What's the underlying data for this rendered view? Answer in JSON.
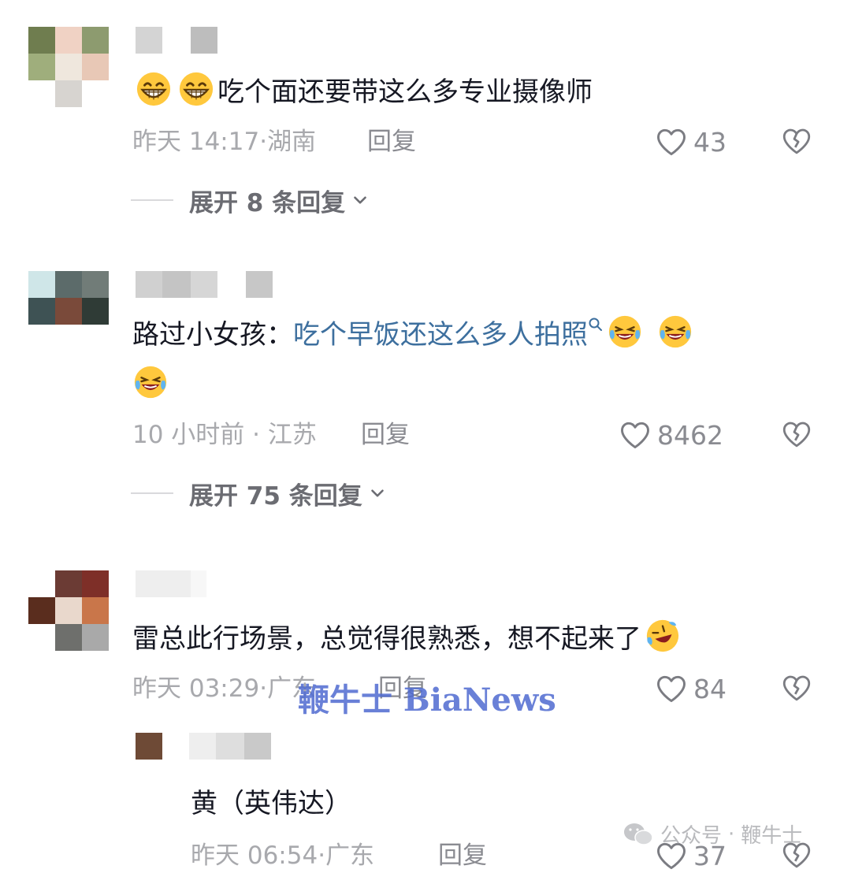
{
  "comments": [
    {
      "text": "吃个面还要带这么多专业摄像师",
      "time": "昨天 14:17",
      "location": "湖南",
      "reply": "回复",
      "likes": "43",
      "expand": "展开 8 条回复"
    },
    {
      "prefix": "路过小女孩：",
      "link_text": "吃个早饭还这么多人拍照",
      "time": "10 小时前",
      "location": "江苏",
      "reply": "回复",
      "likes": "8462",
      "expand": "展开 75 条回复"
    },
    {
      "text": "雷总此行场景，总觉得很熟悉，想不起来了",
      "time": "昨天 03:29",
      "location": "广东",
      "reply": "回复",
      "likes": "84"
    }
  ],
  "sub_reply": {
    "text": "黄（英伟达）",
    "time": "昨天 06:54",
    "location": "广东",
    "reply": "回复",
    "likes": "37"
  },
  "meta_separator": "·",
  "watermark": {
    "main": "鞭牛士 BiaNews",
    "footer_prefix": "公众号",
    "footer_dot": "·",
    "footer_name": "鞭牛士"
  },
  "icons": {
    "like": "heart-outline-icon",
    "dislike": "broken-heart-icon",
    "expand": "chevron-down-icon",
    "grin": "grinning-emoji-icon",
    "laugh": "tears-of-joy-emoji-icon",
    "rofl": "rolling-laughing-emoji-icon",
    "search": "search-icon",
    "wechat": "wechat-icon"
  },
  "colors": {
    "link": "#3d6f9e",
    "meta": "#a8a9ad",
    "watermark": "#4f6bd1"
  }
}
